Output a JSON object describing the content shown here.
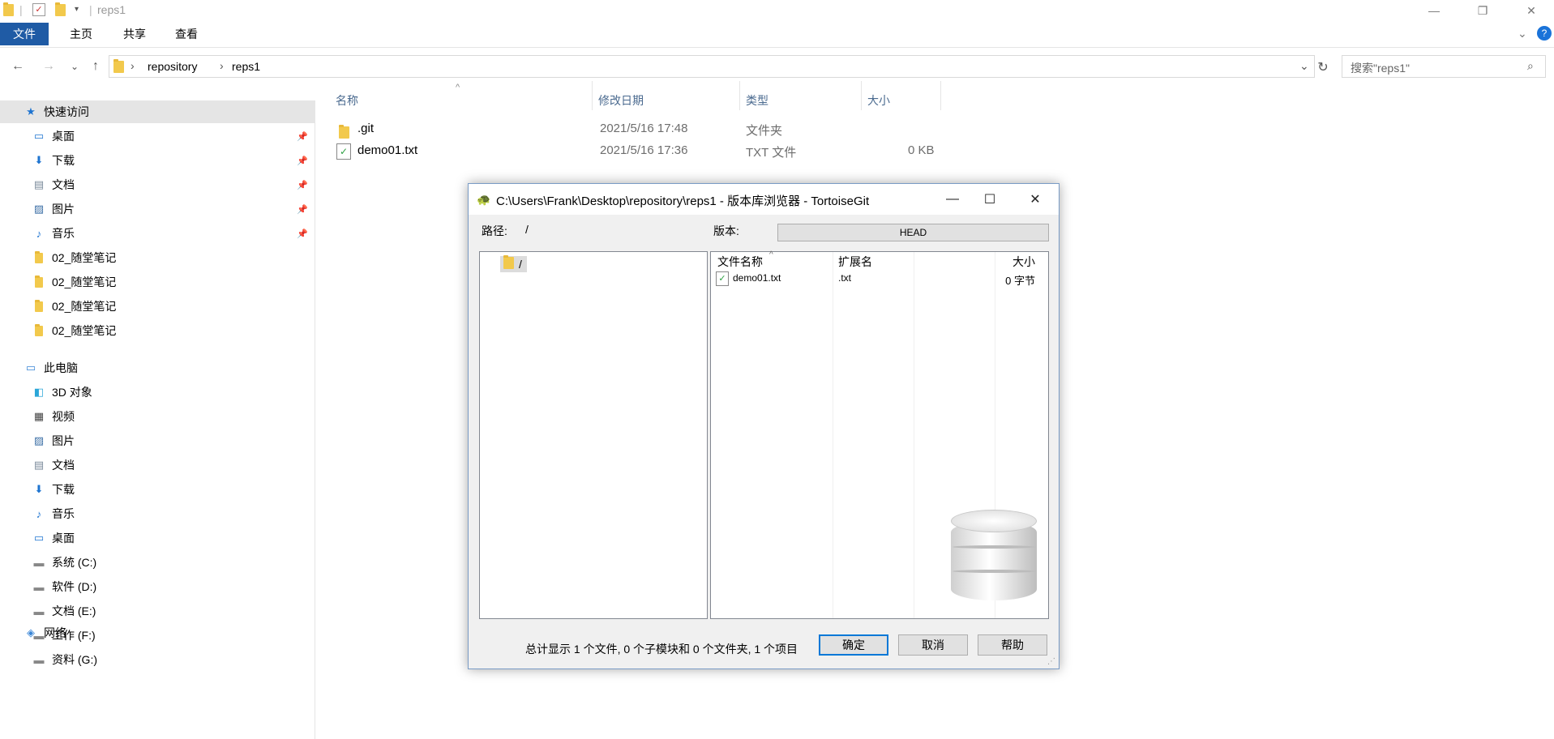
{
  "window": {
    "title": "reps1",
    "controls": {
      "minimize": "—",
      "maximize": "❐",
      "close": "✕"
    }
  },
  "ribbon": {
    "tabs": [
      {
        "label": "文件",
        "active": true
      },
      {
        "label": "主页"
      },
      {
        "label": "共享"
      },
      {
        "label": "查看"
      }
    ]
  },
  "nav": {
    "back": "←",
    "forward": "→",
    "recent": "⌄",
    "up": "↑",
    "refresh": "↻",
    "dropdown": "⌄"
  },
  "address": {
    "segments": [
      "repository",
      "reps1"
    ],
    "separator": "›"
  },
  "search": {
    "placeholder": "搜索\"reps1\""
  },
  "sidebar": {
    "quick_access": "快速访问",
    "quick_items": [
      {
        "label": "桌面",
        "icon": "desktop-icon",
        "pinned": true
      },
      {
        "label": "下载",
        "icon": "download-icon",
        "pinned": true
      },
      {
        "label": "文档",
        "icon": "documents-icon",
        "pinned": true
      },
      {
        "label": "图片",
        "icon": "pictures-icon",
        "pinned": true
      },
      {
        "label": "音乐",
        "icon": "music-icon",
        "pinned": true
      },
      {
        "label": "02_随堂笔记",
        "icon": "folder-icon"
      },
      {
        "label": "02_随堂笔记",
        "icon": "folder-icon"
      },
      {
        "label": "02_随堂笔记",
        "icon": "folder-icon"
      },
      {
        "label": "02_随堂笔记",
        "icon": "folder-icon"
      }
    ],
    "this_pc": "此电脑",
    "pc_items": [
      {
        "label": "3D 对象",
        "icon": "3d-objects-icon"
      },
      {
        "label": "视频",
        "icon": "videos-icon"
      },
      {
        "label": "图片",
        "icon": "pictures-icon"
      },
      {
        "label": "文档",
        "icon": "documents-icon"
      },
      {
        "label": "下载",
        "icon": "download-icon"
      },
      {
        "label": "音乐",
        "icon": "music-icon"
      },
      {
        "label": "桌面",
        "icon": "desktop-icon"
      },
      {
        "label": "系统 (C:)",
        "icon": "drive-icon"
      },
      {
        "label": "软件 (D:)",
        "icon": "drive-icon"
      },
      {
        "label": "文档 (E:)",
        "icon": "drive-icon"
      },
      {
        "label": "工作 (F:)",
        "icon": "drive-icon"
      },
      {
        "label": "资料 (G:)",
        "icon": "drive-icon"
      }
    ],
    "network": "网络"
  },
  "files": {
    "columns": [
      "名称",
      "修改日期",
      "类型",
      "大小"
    ],
    "rows": [
      {
        "name": ".git",
        "date": "2021/5/16 17:48",
        "type": "文件夹",
        "size": ""
      },
      {
        "name": "demo01.txt",
        "date": "2021/5/16 17:36",
        "type": "TXT 文件",
        "size": "0 KB"
      }
    ]
  },
  "dialog": {
    "title": "C:\\Users\\Frank\\Desktop\\repository\\reps1 - 版本库浏览器 - TortoiseGit",
    "path_label": "路径:",
    "path_value": "/",
    "version_label": "版本:",
    "version_value": "HEAD",
    "tree_root": "/",
    "list_columns": [
      "文件名称",
      "扩展名",
      "大小"
    ],
    "list_rows": [
      {
        "name": "demo01.txt",
        "ext": ".txt",
        "size": "0 字节"
      }
    ],
    "summary": "总计显示 1 个文件, 0 个子模块和 0 个文件夹, 1 个项目",
    "buttons": {
      "ok": "确定",
      "cancel": "取消",
      "help": "帮助"
    }
  }
}
